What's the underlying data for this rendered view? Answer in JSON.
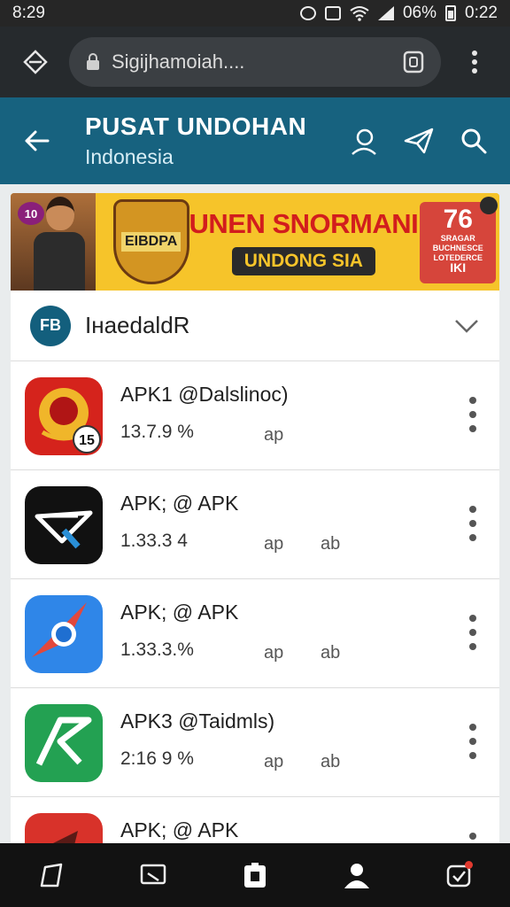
{
  "status_bar": {
    "time": "8:29",
    "battery": "06%",
    "clock_right": "0:22"
  },
  "browser": {
    "url": "Sigijhamoiah...."
  },
  "header": {
    "title": "PUSAT UNDOHAN",
    "subtitle": "Indonesia"
  },
  "banner": {
    "badge": "10",
    "shield_text": "EIBDPA",
    "headline": "UNEN SNORMANI",
    "subline": "UNDONG SIA",
    "promo_number": "76",
    "promo_lines": [
      "SRAGAR",
      "BUCHNESCE",
      "LOTEDERCE"
    ],
    "promo_tag": "IKI"
  },
  "dropdown": {
    "avatar_text": "FB",
    "label": "ІнaedaldR"
  },
  "apps": [
    {
      "name": "APK1 @Dalslinoc)",
      "version": "13.7.9 %",
      "meta1": "ap",
      "meta2": "",
      "icon": "emblem-icon",
      "badge": "15"
    },
    {
      "name": "APK; @ APK",
      "version": "1.33.3 4‍",
      "meta1": "ap",
      "meta2": "ab",
      "icon": "paper-plane-icon"
    },
    {
      "name": "APK; @ APK",
      "version": "1.33.3.%",
      "meta1": "ap",
      "meta2": "ab",
      "icon": "compass-icon"
    },
    {
      "name": "APK3 @Taidmls)",
      "version": "2:16 9 %",
      "meta1": "ap",
      "meta2": "ab",
      "icon": "arrow-a-icon"
    },
    {
      "name": "APK; @ APK",
      "version": "",
      "meta1": "",
      "meta2": "",
      "icon": "red-arrow-icon"
    }
  ],
  "colors": {
    "header": "#17627f",
    "banner": "#f6c42a",
    "headline": "#d21d1d",
    "browser": "#262a2d",
    "nav": "#121212"
  }
}
